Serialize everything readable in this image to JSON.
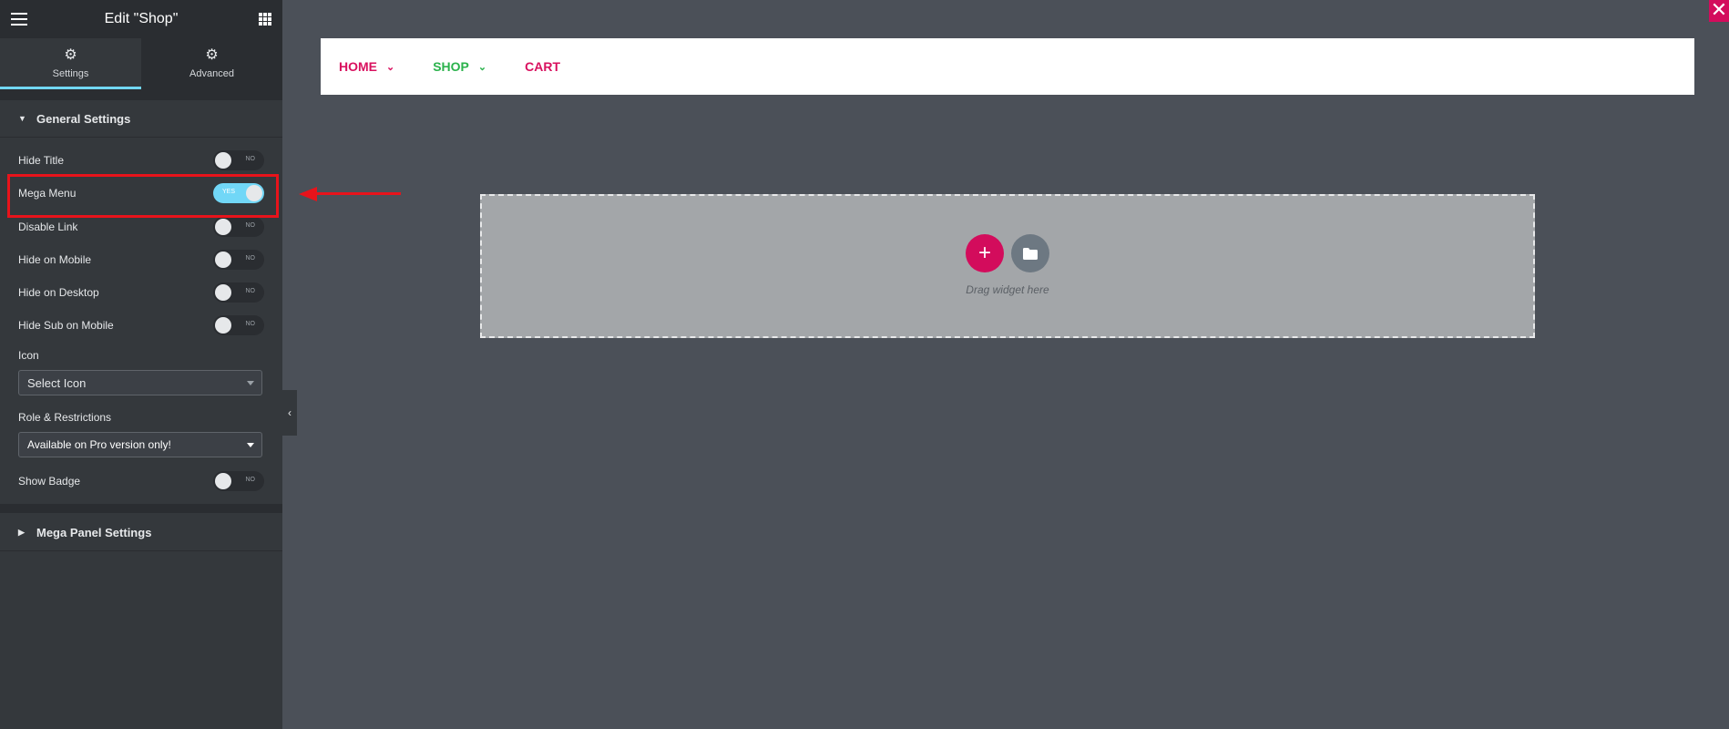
{
  "header": {
    "title": "Edit \"Shop\"",
    "menu_icon": "hamburger-icon",
    "apps_icon": "grid-apps-icon"
  },
  "tabs": [
    {
      "label": "Settings",
      "icon": "gear-icon",
      "active": true
    },
    {
      "label": "Advanced",
      "icon": "gear-icon",
      "active": false
    }
  ],
  "general_settings": {
    "title": "General Settings",
    "toggles": [
      {
        "label": "Hide Title",
        "state": "NO"
      },
      {
        "label": "Mega Menu",
        "state": "YES"
      },
      {
        "label": "Disable Link",
        "state": "NO"
      },
      {
        "label": "Hide on Mobile",
        "state": "NO"
      },
      {
        "label": "Hide on Desktop",
        "state": "NO"
      },
      {
        "label": "Hide Sub on Mobile",
        "state": "NO"
      }
    ],
    "icon_label": "Icon",
    "icon_select": "Select Icon",
    "role_label": "Role & Restrictions",
    "role_select": "Available on Pro version only!",
    "badge_label": "Show Badge",
    "badge_state": "NO"
  },
  "mega_panel": {
    "title": "Mega Panel Settings"
  },
  "canvas": {
    "nav": [
      {
        "label": "HOME",
        "color": "#d9115f",
        "has_dropdown": true
      },
      {
        "label": "SHOP",
        "color": "#2bb24c",
        "has_dropdown": true
      },
      {
        "label": "CART",
        "color": "#d9115f",
        "has_dropdown": false
      }
    ],
    "dropzone_text": "Drag widget here",
    "add_icon": "plus-icon",
    "template_icon": "folder-icon",
    "close_icon": "close-icon"
  },
  "colors": {
    "accent_pink": "#d30c5c",
    "toggle_on": "#71d7f7",
    "annotation_red": "#e8131b"
  }
}
